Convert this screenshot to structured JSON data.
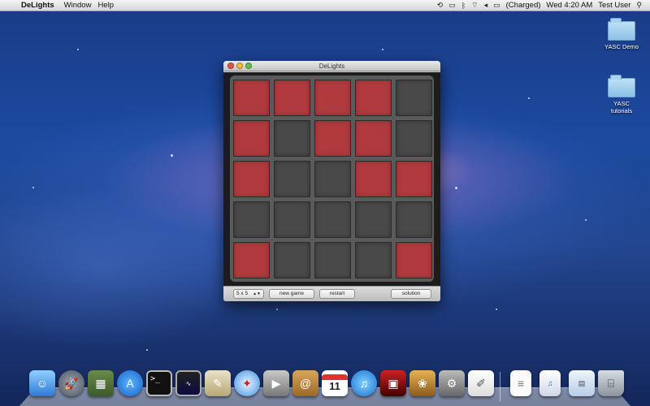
{
  "menubar": {
    "apple": "",
    "app_name": "DeLights",
    "items": [
      "Window",
      "Help"
    ],
    "battery": "(Charged)",
    "clock": "Wed 4:20 AM",
    "user": "Test User"
  },
  "desktop": {
    "icons": [
      {
        "label": "YASC Demo",
        "icon": "folder-icon"
      },
      {
        "label": "YASC tutorials",
        "icon": "folder-icon"
      }
    ]
  },
  "window": {
    "title": "DeLights",
    "board": {
      "rows": 5,
      "cols": 5,
      "lights": [
        [
          1,
          1,
          1,
          1,
          0
        ],
        [
          1,
          0,
          1,
          1,
          0
        ],
        [
          1,
          0,
          0,
          1,
          1
        ],
        [
          0,
          0,
          0,
          0,
          0
        ],
        [
          1,
          0,
          0,
          0,
          1
        ]
      ]
    },
    "toolbar": {
      "size_value": "5 x 5",
      "new_game": "new game",
      "restart": "restart",
      "solution": "solution"
    }
  },
  "dock": {
    "apps": [
      "finder-icon",
      "launchpad-icon",
      "photo-booth-icon",
      "app-store-icon",
      "terminal-icon",
      "activity-monitor-icon",
      "preview-icon",
      "safari-icon",
      "facetime-icon",
      "address-book-icon",
      "ical-icon",
      "itunes-icon",
      "photo-slideshow-icon",
      "iphoto-icon",
      "system-preferences-icon",
      "textedit-icon"
    ],
    "ical_date": "11",
    "right_items": [
      "document-icon",
      "mp3-file-icon",
      "folder-stack-icon",
      "trash-icon"
    ]
  },
  "colors": {
    "light_on": "#b13a3e",
    "light_off": "#494949"
  }
}
